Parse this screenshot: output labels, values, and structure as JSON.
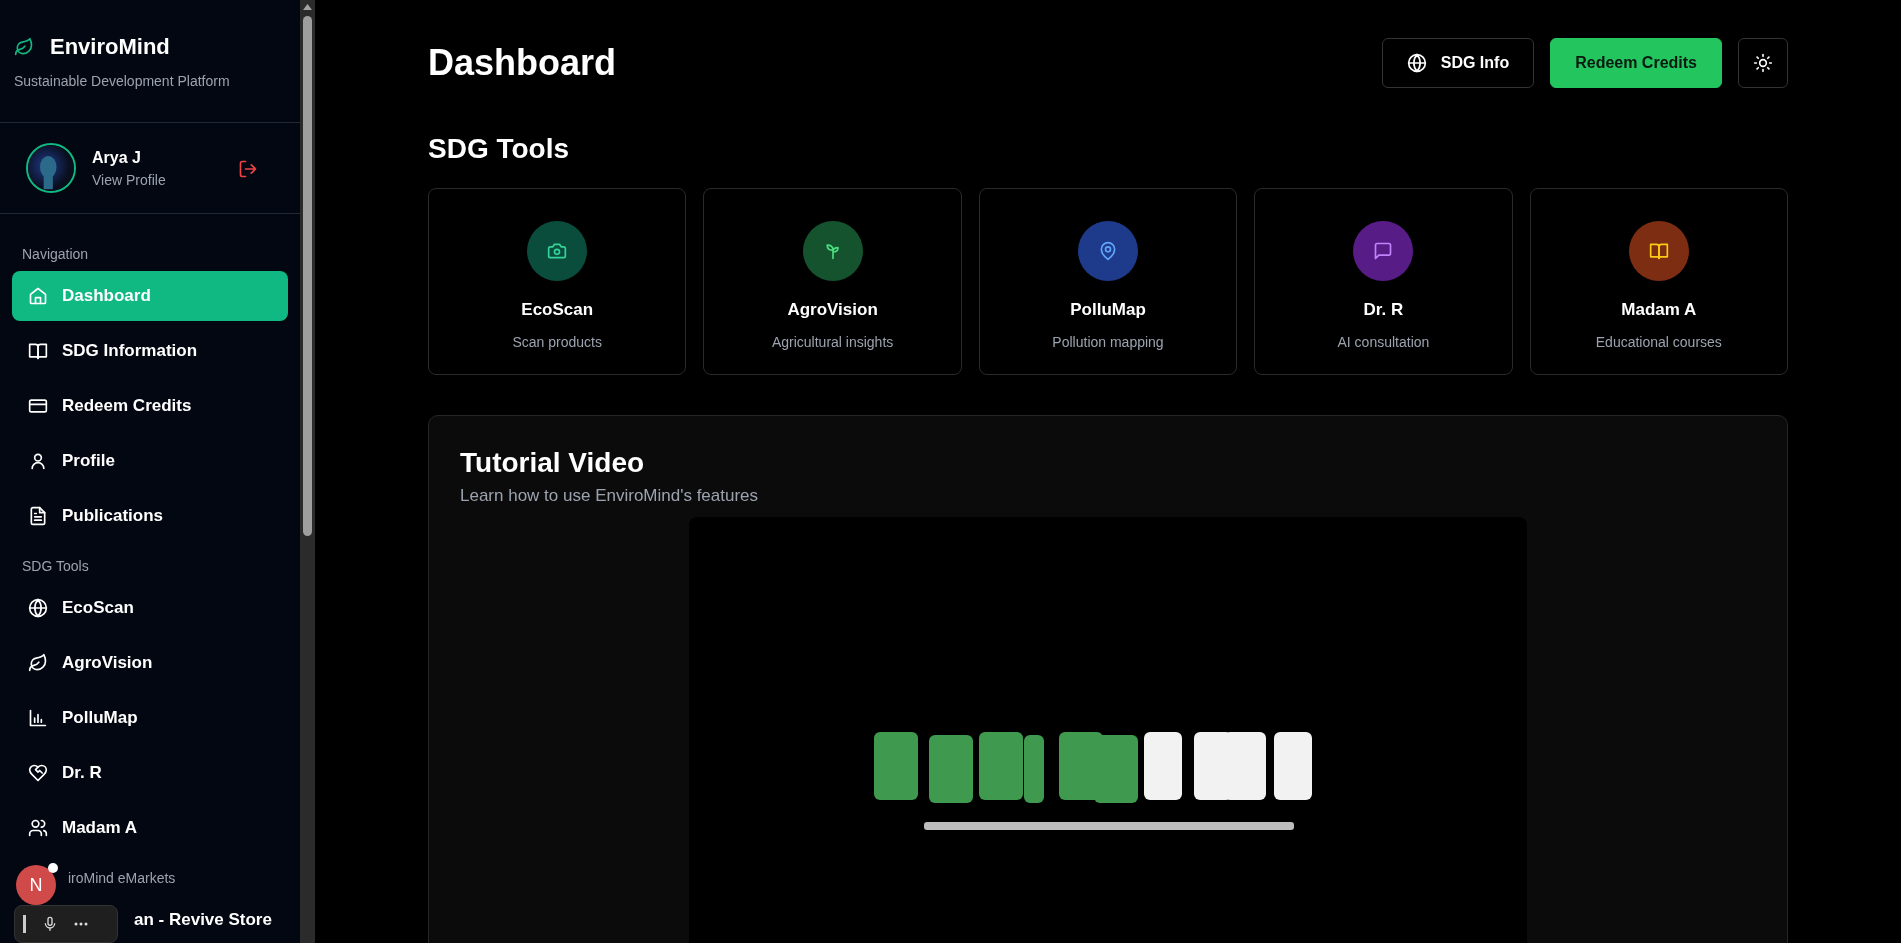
{
  "sidebar": {
    "brand": "EnviroMind",
    "tagline": "Sustainable Development Platform",
    "user": {
      "name": "Arya J",
      "link": "View Profile"
    },
    "sections": [
      {
        "title": "Navigation",
        "items": [
          {
            "label": "Dashboard",
            "selected": true
          },
          {
            "label": "SDG Information",
            "selected": false
          },
          {
            "label": "Redeem Credits",
            "selected": false
          },
          {
            "label": "Profile",
            "selected": false
          },
          {
            "label": "Publications",
            "selected": false
          }
        ]
      },
      {
        "title": "SDG Tools",
        "items": [
          {
            "label": "EcoScan",
            "selected": false
          },
          {
            "label": "AgroVision",
            "selected": false
          },
          {
            "label": "PolluMap",
            "selected": false
          },
          {
            "label": "Dr. R",
            "selected": false
          },
          {
            "label": "Madam A",
            "selected": false
          }
        ]
      },
      {
        "title": "iroMind eMarkets",
        "items": [
          {
            "label": "an - Revive Store",
            "selected": false
          }
        ]
      }
    ]
  },
  "overlay": {
    "avatar": "N"
  },
  "header": {
    "title": "Dashboard",
    "buttons": [
      {
        "label": "SDG Info",
        "kind": "outline"
      },
      {
        "label": "Redeem Credits",
        "kind": "primary"
      }
    ]
  },
  "tools": {
    "title": "SDG Tools",
    "cards": [
      {
        "name": "EcoScan",
        "description": "Scan products",
        "color": "#0b4d3c"
      },
      {
        "name": "AgroVision",
        "description": "Agricultural insights",
        "color": "#14532d"
      },
      {
        "name": "PolluMap",
        "description": "Pollution mapping",
        "color": "#1e3a8a"
      },
      {
        "name": "Dr. R",
        "description": "AI consultation",
        "color": "#581c87"
      },
      {
        "name": "Madam A",
        "description": "Educational courses",
        "color": "#7c2d12"
      }
    ]
  },
  "tutorial": {
    "title": "Tutorial Video",
    "subtitle": "Learn how to use EnviroMind's features"
  }
}
